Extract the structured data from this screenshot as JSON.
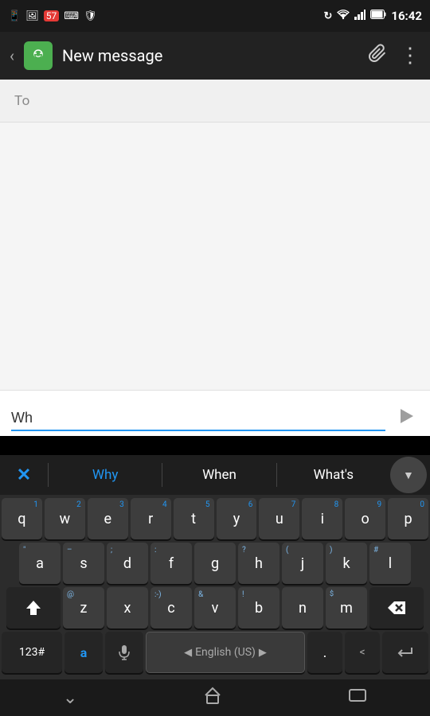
{
  "statusBar": {
    "time": "16:42",
    "leftIcons": [
      "📱",
      "🖼",
      "57",
      "⌨",
      "🛡"
    ],
    "rightIcons": [
      "↻",
      "wifi",
      "signal",
      "battery"
    ]
  },
  "appBar": {
    "title": "New message",
    "backLabel": "‹",
    "attachIcon": "📎",
    "moreIcon": "⋮"
  },
  "compose": {
    "toLabel": "To",
    "toPlaceholder": ""
  },
  "inputBar": {
    "textValue": "Wh",
    "sendLabel": "➤"
  },
  "suggestions": {
    "closeLabel": "✕",
    "items": [
      "Why",
      "When",
      "What's"
    ],
    "activeIndex": 0,
    "dropdownLabel": "▼"
  },
  "keyboard": {
    "row1": [
      {
        "char": "q",
        "num": "1"
      },
      {
        "char": "w",
        "num": "2"
      },
      {
        "char": "e",
        "num": "3"
      },
      {
        "char": "r",
        "num": "4"
      },
      {
        "char": "t",
        "num": "5"
      },
      {
        "char": "y",
        "num": "6"
      },
      {
        "char": "u",
        "num": "7"
      },
      {
        "char": "i",
        "num": "8"
      },
      {
        "char": "o",
        "num": "9"
      },
      {
        "char": "p",
        "num": "0"
      }
    ],
    "row2": [
      {
        "char": "a",
        "alt": "\""
      },
      {
        "char": "s",
        "alt": "–"
      },
      {
        "char": "d",
        "alt": ";"
      },
      {
        "char": "f",
        "alt": ":"
      },
      {
        "char": "g"
      },
      {
        "char": "h",
        "alt": "?"
      },
      {
        "char": "j",
        "alt": "("
      },
      {
        "char": "k",
        "alt": ")"
      },
      {
        "char": "l",
        "alt": "#"
      }
    ],
    "row3": [
      {
        "char": "z",
        "alt": "@"
      },
      {
        "char": "x"
      },
      {
        "char": "c",
        "alt": ":-)"
      },
      {
        "char": "v",
        "alt": "&"
      },
      {
        "char": "b",
        "alt": "!"
      },
      {
        "char": "n"
      },
      {
        "char": "m",
        "alt": "/",
        "alt2": "$"
      }
    ],
    "spacebar": "English (US)",
    "numKey": "123#",
    "commaKey": ",",
    "periodKey": ".",
    "emojiKey": "a"
  },
  "bottomNav": {
    "backLabel": "⌄",
    "homeLabel": "⌂",
    "recentLabel": "▭"
  }
}
